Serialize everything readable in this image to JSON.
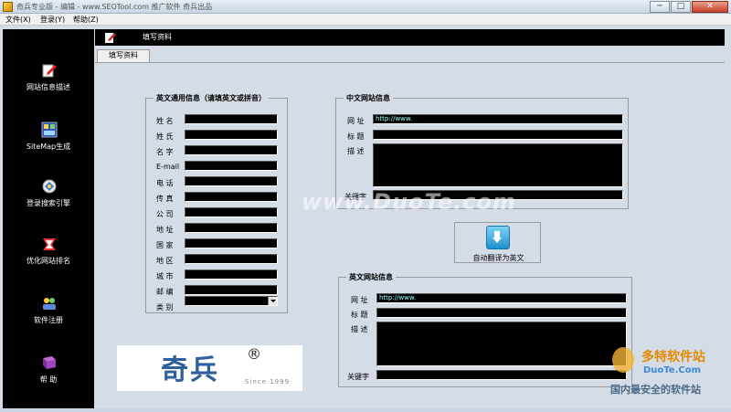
{
  "window": {
    "title": "奇兵专业版  - 编辑 - www.SEOTool.com 推广软件 奇兵出品",
    "minimize": "─",
    "maximize": "□",
    "close": "✕"
  },
  "menu": [
    {
      "label": "文件(X)"
    },
    {
      "label": "登录(Y)"
    },
    {
      "label": "帮助(Z)"
    }
  ],
  "sidebar": {
    "items": [
      {
        "label": "网站信息描述",
        "icon": "edit-icon"
      },
      {
        "label": "SiteMap生成",
        "icon": "sitemap-icon"
      },
      {
        "label": "登录搜索引擎",
        "icon": "submit-icon"
      },
      {
        "label": "优化网站排名",
        "icon": "rank-icon"
      },
      {
        "label": "软件注册",
        "icon": "register-icon"
      },
      {
        "label": "帮 助",
        "icon": "help-icon"
      }
    ]
  },
  "toolbar": {
    "label": "填写资料"
  },
  "tab": {
    "label": "填写资料"
  },
  "english_general": {
    "title": "英文通用信息（请填英文或拼音）",
    "fields": [
      {
        "label": "姓  名",
        "value": ""
      },
      {
        "label": "姓  氏",
        "value": ""
      },
      {
        "label": "名  字",
        "value": ""
      },
      {
        "label": "E-mail",
        "value": ""
      },
      {
        "label": "电  话",
        "value": ""
      },
      {
        "label": "传  真",
        "value": ""
      },
      {
        "label": "公  司",
        "value": ""
      },
      {
        "label": "地  址",
        "value": ""
      },
      {
        "label": "国  家",
        "value": ""
      },
      {
        "label": "地  区",
        "value": ""
      },
      {
        "label": "城  市",
        "value": ""
      },
      {
        "label": "邮  编",
        "value": ""
      },
      {
        "label": "类  别",
        "value": ""
      }
    ]
  },
  "chinese_site": {
    "title": "中文网站信息",
    "url_label": "网  址",
    "url_value": "http://www.",
    "title_label": "标  题",
    "title_value": "",
    "desc_label": "描  述",
    "desc_value": "",
    "keywords_label": "关键字",
    "keywords_value": ""
  },
  "translate_button": {
    "label": "自动翻译为英文"
  },
  "english_site": {
    "title": "英文网站信息",
    "url_label": "网  址",
    "url_value": "http://www.",
    "title_label": "标  题",
    "title_value": "",
    "desc_label": "描  述",
    "desc_value": "",
    "keywords_label": "关键字",
    "keywords_value": ""
  },
  "logo": {
    "text": "奇兵",
    "reg": "®",
    "since": "Since 1999"
  },
  "watermarks": {
    "center": "www.DuoTe.com",
    "corner_name": "多特软件站",
    "corner_url": "DuoTe.Com",
    "corner_slogan": "国内最安全的软件站"
  },
  "colors": {
    "field_bg": "#000000",
    "sidebar_bg": "#000000",
    "panel_bg": "#d4dde6",
    "logo_blue": "#2e5f9e"
  }
}
